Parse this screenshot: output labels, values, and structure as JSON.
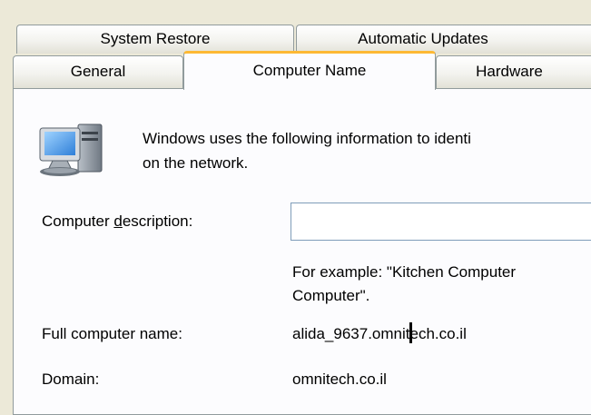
{
  "tabs_row1": [
    {
      "label": "System Restore"
    },
    {
      "label": "Automatic Updates"
    },
    {
      "label": ""
    }
  ],
  "tabs_row2": [
    {
      "label": "General"
    },
    {
      "label": "Computer Name",
      "active": true
    },
    {
      "label": "Hardware"
    }
  ],
  "intro": {
    "line1": "Windows uses the following information to identi",
    "line2": "on the network."
  },
  "description": {
    "label_pre": "Computer ",
    "label_accel": "d",
    "label_post": "escription:",
    "value": "",
    "example_line1": "For example: \"Kitchen Computer",
    "example_line2": "Computer\"."
  },
  "full_name": {
    "label": "Full computer name:",
    "value": "alida_9637.omnitech.co.il"
  },
  "domain": {
    "label": "Domain:",
    "value": "omnitech.co.il"
  },
  "colors": {
    "dialog_bg": "#ece9d8",
    "panel_bg": "#fcfcfe",
    "tab_border": "#919b9c",
    "active_tab_accent": "#fdb934",
    "input_border": "#7f9db9"
  },
  "icons": [
    "computer-network-icon"
  ]
}
